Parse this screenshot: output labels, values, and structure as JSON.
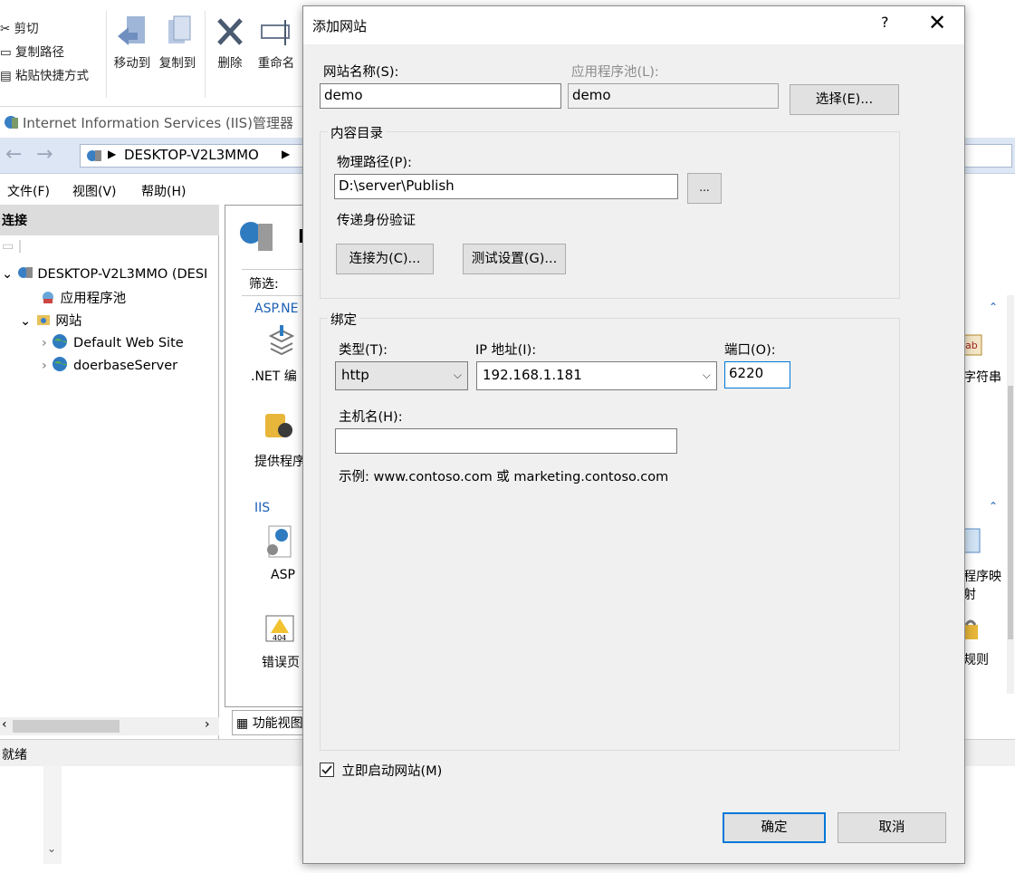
{
  "ribbon": {
    "cut": "剪切",
    "copy_path": "复制路径",
    "paste_shortcut": "粘贴快捷方式",
    "move_to": "移动到",
    "copy_to": "复制到",
    "delete": "删除",
    "rename": "重命名"
  },
  "iis": {
    "window_title": "Internet Information Services (IIS)管理器",
    "address": "DESKTOP-V2L3MMO",
    "menu": {
      "file": "文件(F)",
      "view": "视图(V)",
      "help": "帮助(H)"
    },
    "connections_title": "连接",
    "tree": {
      "server": "DESKTOP-V2L3MMO (DESI",
      "app_pools": "应用程序池",
      "sites": "网站",
      "site1": "Default Web Site",
      "site2": "doerbaseServer"
    },
    "main": {
      "server_initial": "D",
      "filter": "筛选:",
      "aspnet_group": "ASP.NE",
      "net_compile": ".NET 编",
      "providers": "提供程序",
      "iis_group": "IIS",
      "asp": "ASP",
      "error_pages": "错误页",
      "features_view": "功能视图"
    },
    "right": {
      "conn_strings": "字符串",
      "handler_map_1": "程序映",
      "handler_map_2": "射",
      "rules": "规则"
    },
    "status": "就绪"
  },
  "dialog": {
    "title": "添加网站",
    "help": "?",
    "close": "✕",
    "site_name_label": "网站名称(S):",
    "site_name_value": "demo",
    "app_pool_label": "应用程序池(L):",
    "app_pool_value": "demo",
    "select_button": "选择(E)...",
    "content_dir_title": "内容目录",
    "physical_path_label": "物理路径(P):",
    "physical_path_value": "D:\\server\\Publish",
    "browse_button": "...",
    "pass_auth_label": "传递身份验证",
    "connect_as_button": "连接为(C)...",
    "test_settings_button": "测试设置(G)...",
    "binding_title": "绑定",
    "type_label": "类型(T):",
    "type_value": "http",
    "ip_label": "IP 地址(I):",
    "ip_value": "192.168.1.181",
    "port_label": "端口(O):",
    "port_value": "6220",
    "hostname_label": "主机名(H):",
    "hostname_value": "",
    "example_text": "示例: www.contoso.com 或 marketing.contoso.com",
    "start_now_label": "立即启动网站(M)",
    "start_now_checked": true,
    "ok_button": "确定",
    "cancel_button": "取消"
  }
}
